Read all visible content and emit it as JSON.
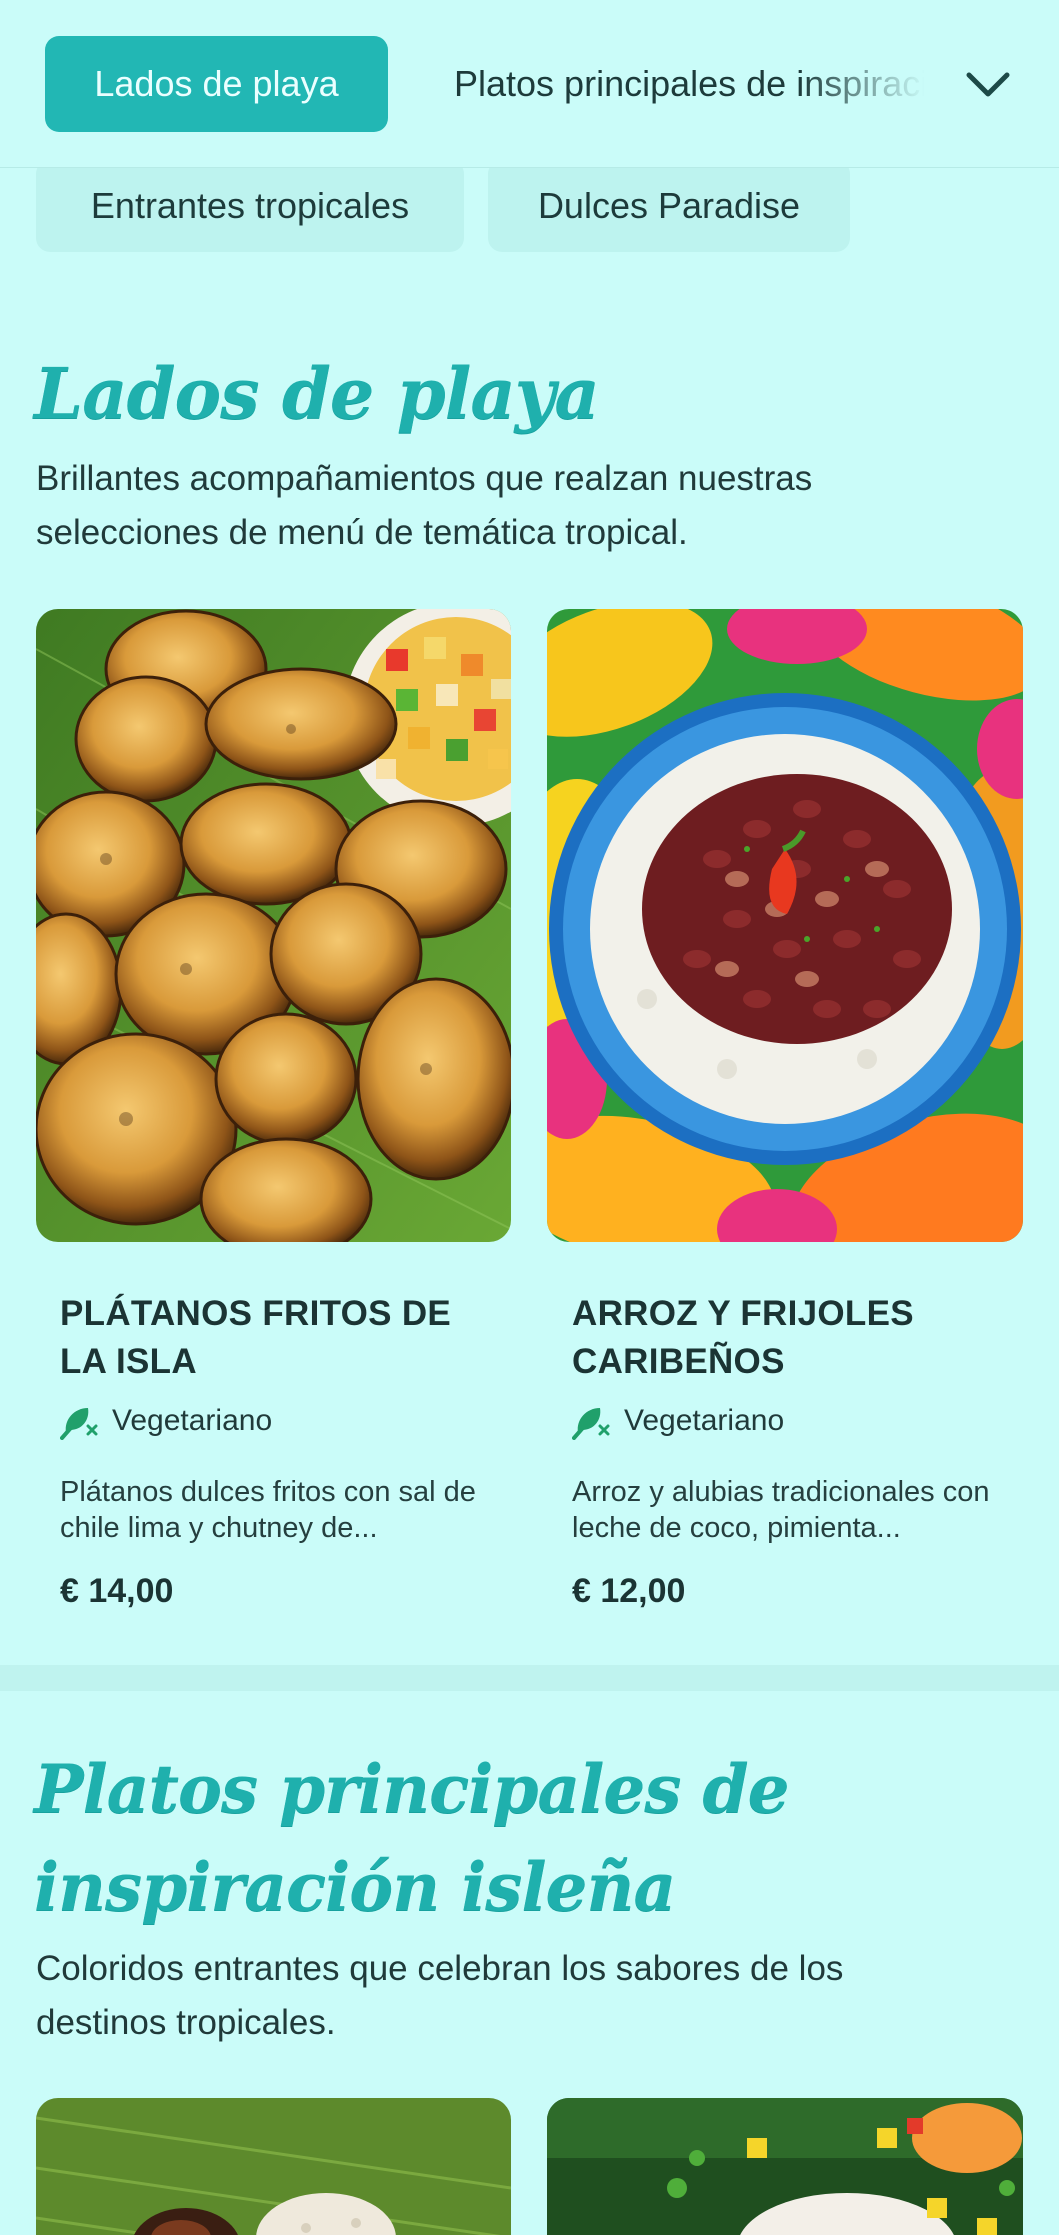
{
  "nav": {
    "active_tab": "Lados de playa",
    "next_tab": "Platos principales de inspiración isleña",
    "tabs": [
      "Entrantes tropicales",
      "Dulces Paradise"
    ]
  },
  "sections": [
    {
      "title": "Lados de playa",
      "description": "Brillantes acompañamientos que realzan nuestras selecciones de menú de temática tropical.",
      "items": [
        {
          "name": "PLÁTANOS FRITOS DE LA ISLA",
          "tag": "Vegetariano",
          "description": "Plátanos dulces fritos con sal de chile lima y chutney de...",
          "price": "€ 14,00"
        },
        {
          "name": "ARROZ Y FRIJOLES CARIBEÑOS",
          "tag": "Vegetariano",
          "description": "Arroz y alubias tradicionales con leche de coco, pimienta...",
          "price": "€ 12,00"
        }
      ]
    },
    {
      "title": "Platos principales de inspiración isleña",
      "description": "Coloridos entrantes que celebran los sabores de los destinos tropicales."
    }
  ],
  "colors": {
    "background": "#cafcf9",
    "accent": "#22b7b4",
    "veg_icon": "#20a06b"
  }
}
